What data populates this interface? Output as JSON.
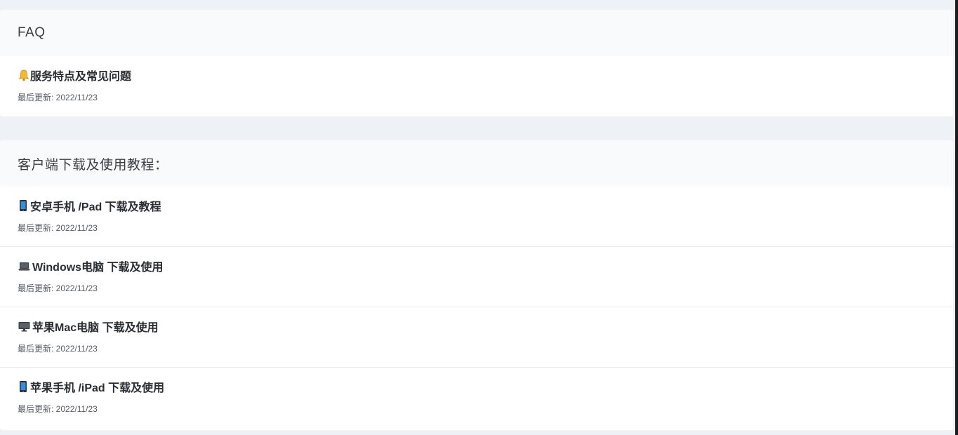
{
  "faq": {
    "header": "FAQ",
    "items": [
      {
        "icon": "bell-icon",
        "title": "服务特点及常见问题",
        "date": "最后更新: 2022/11/23"
      }
    ]
  },
  "client": {
    "header": "客户端下载及使用教程：",
    "items": [
      {
        "icon": "mobile-phone-icon",
        "title": "安卓手机 /Pad 下载及教程",
        "date": "最后更新: 2022/11/23"
      },
      {
        "icon": "laptop-icon",
        "title": "Windows电脑 下载及使用",
        "date": "最后更新: 2022/11/23"
      },
      {
        "icon": "desktop-monitor-icon",
        "title": "苹果Mac电脑 下载及使用",
        "date": "最后更新: 2022/11/23"
      },
      {
        "icon": "mobile-phone-icon",
        "title": "苹果手机 /iPad 下载及使用",
        "date": "最后更新: 2022/11/23"
      }
    ]
  },
  "colors": {
    "background": "#eef2f7",
    "card": "#ffffff",
    "header_bg": "#f9fafb",
    "bell": "#f5b82e",
    "phone": "#2f8fe0"
  }
}
